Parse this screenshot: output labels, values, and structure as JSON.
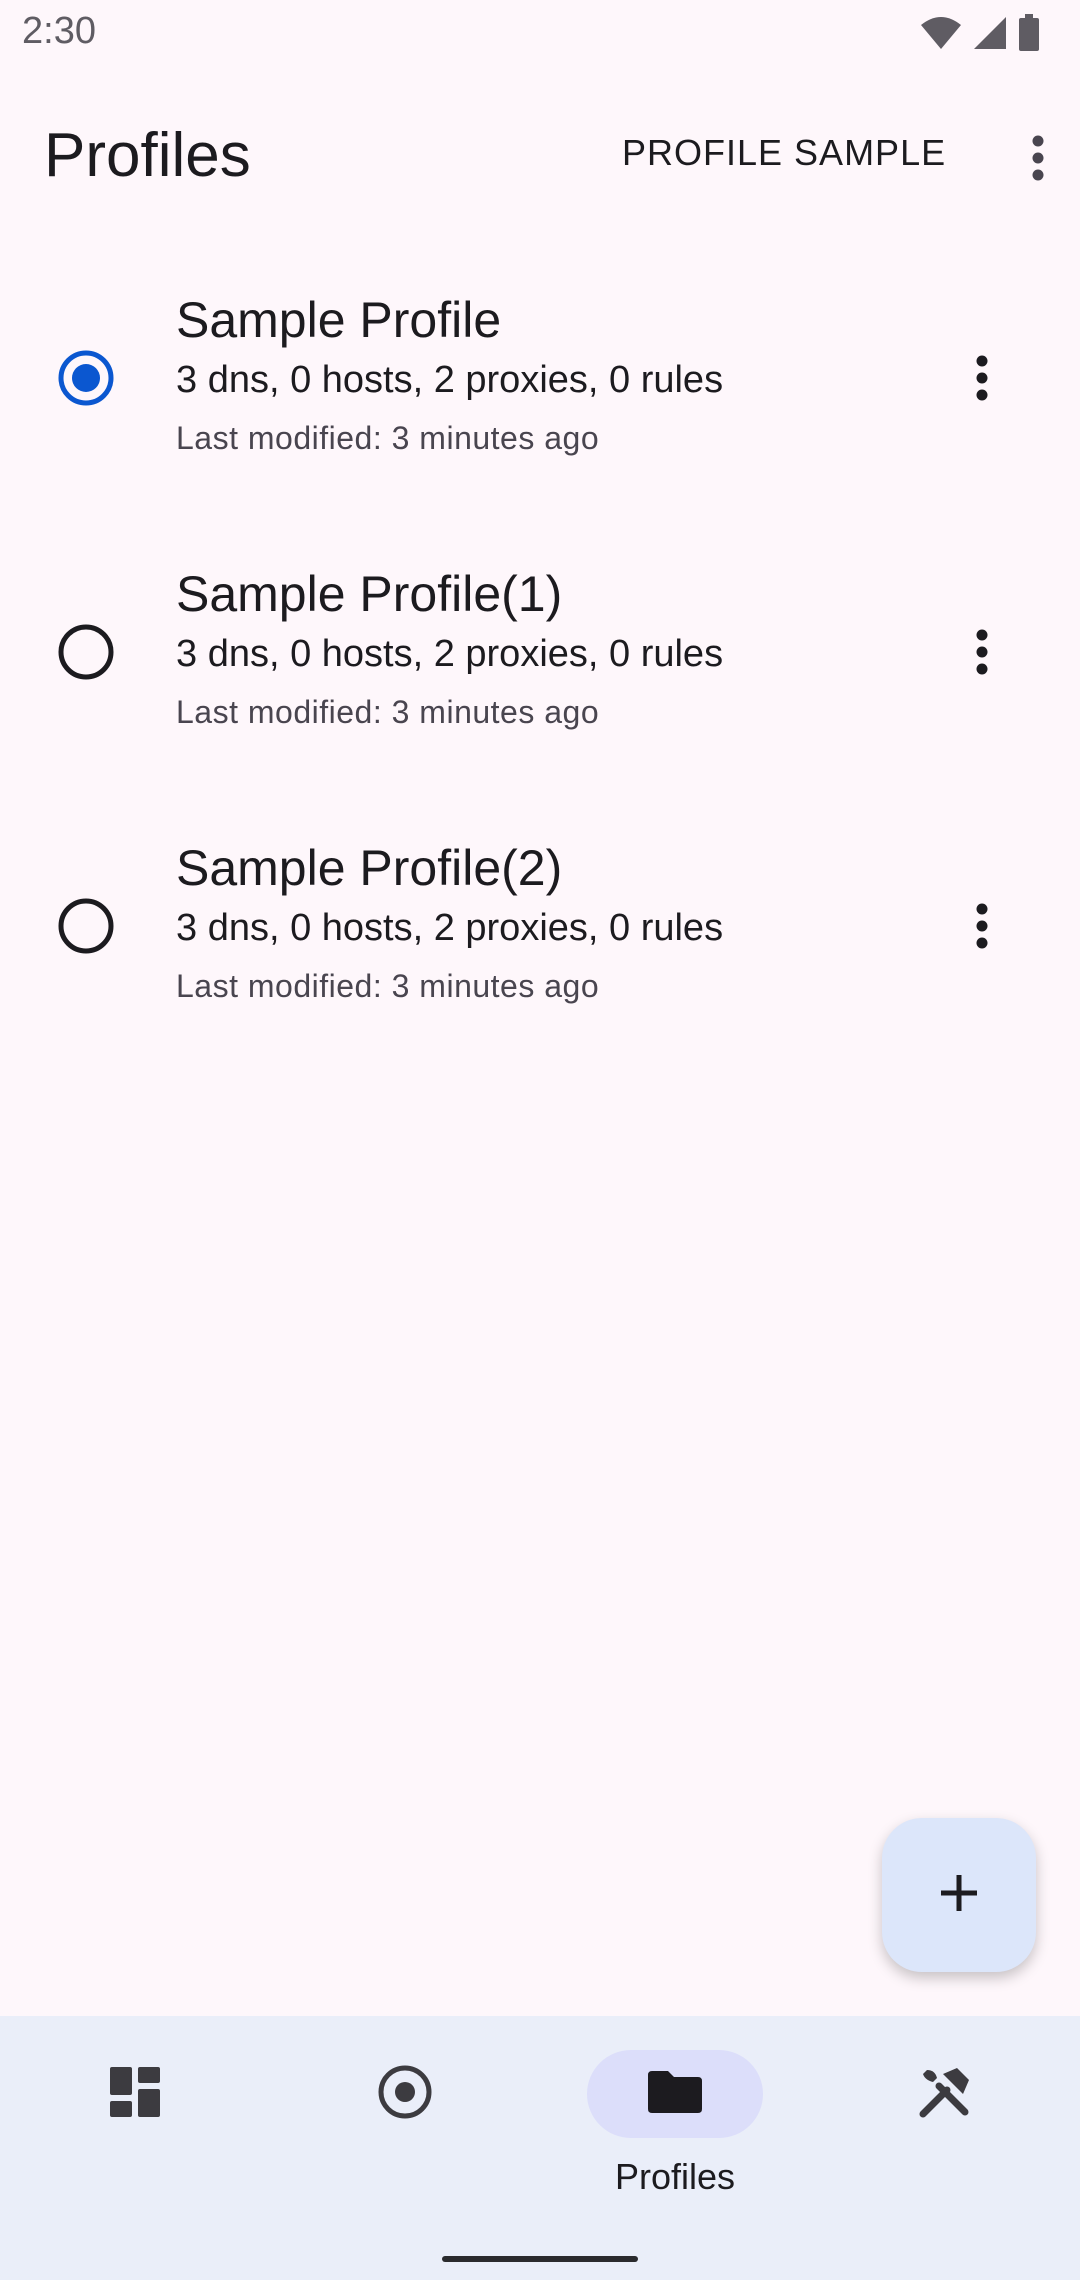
{
  "status_bar": {
    "time": "2:30",
    "icons": [
      "wifi-icon",
      "signal-icon",
      "battery-icon"
    ]
  },
  "app_bar": {
    "title": "Profiles",
    "action_label": "PROFILE SAMPLE",
    "overflow_icon": "more-vert-icon"
  },
  "profiles": [
    {
      "name": "Sample Profile",
      "summary": "3 dns, 0 hosts, 2 proxies, 0 rules",
      "modified": "Last modified: 3 minutes ago",
      "selected": true
    },
    {
      "name": "Sample Profile(1)",
      "summary": "3 dns, 0 hosts, 2 proxies, 0 rules",
      "modified": "Last modified: 3 minutes ago",
      "selected": false
    },
    {
      "name": "Sample Profile(2)",
      "summary": "3 dns, 0 hosts, 2 proxies, 0 rules",
      "modified": "Last modified: 3 minutes ago",
      "selected": false
    }
  ],
  "fab": {
    "icon": "add-icon"
  },
  "bottom_nav": {
    "items": [
      {
        "icon": "dashboard-icon",
        "label": "",
        "active": false
      },
      {
        "icon": "radio-target-icon",
        "label": "",
        "active": false
      },
      {
        "icon": "folder-icon",
        "label": "Profiles",
        "active": true
      },
      {
        "icon": "tools-icon",
        "label": "",
        "active": false
      }
    ]
  },
  "colors": {
    "background": "#fef7fb",
    "accent": "#0b57d0",
    "fab_background": "#dce6fa",
    "nav_background": "#eaeef9",
    "nav_active_pill": "#dcdefa",
    "text_primary": "#1c1b1f",
    "text_secondary": "#49454f"
  }
}
